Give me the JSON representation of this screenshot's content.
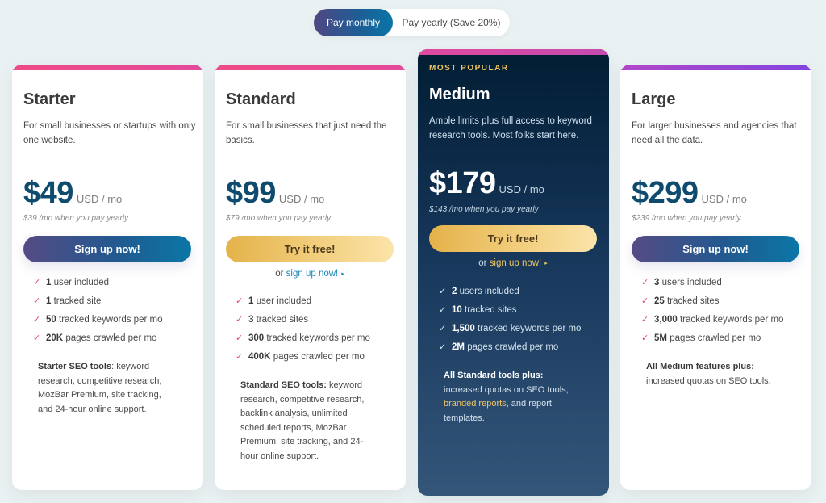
{
  "billing_toggle": {
    "monthly_label": "Pay monthly",
    "yearly_label": "Pay yearly (Save 20%)",
    "selected": "monthly"
  },
  "colors": {
    "accent_pink": "#e0457b",
    "primary_gradient_start": "#554b85",
    "primary_gradient_end": "#0a77a7",
    "gold": "#f0c560",
    "price_blue": "#0e4b6e",
    "featured_bg": "#16365a"
  },
  "plans": [
    {
      "name": "Starter",
      "description": "For small businesses or startups with only one website.",
      "price": "$49",
      "unit": "USD / mo",
      "yearly_note": "$39 /mo when you pay yearly",
      "cta_label": "Sign up now!",
      "features": [
        {
          "value": "1",
          "text": "user included"
        },
        {
          "value": "1",
          "text": "tracked site"
        },
        {
          "value": "50",
          "text": "tracked keywords per mo"
        },
        {
          "value": "20K",
          "text": "pages crawled per mo"
        }
      ],
      "tools_bold": "Starter SEO tools",
      "tools_text": ": keyword research, competitive research, MozBar Premium, site tracking, and 24-hour online support."
    },
    {
      "name": "Standard",
      "description": "For small businesses that just need the basics.",
      "price": "$99",
      "unit": "USD / mo",
      "yearly_note": "$79 /mo when you pay yearly",
      "cta_label": "Try it free!",
      "alt_prefix": "or",
      "alt_link": "sign up now!",
      "features": [
        {
          "value": "1",
          "text": "user included"
        },
        {
          "value": "3",
          "text": "tracked sites"
        },
        {
          "value": "300",
          "text": "tracked keywords per mo"
        },
        {
          "value": "400K",
          "text": "pages crawled per mo"
        }
      ],
      "tools_bold": "Standard SEO tools:",
      "tools_text": " keyword research, competitive research, backlink analysis, unlimited scheduled reports, MozBar Premium, site tracking, and 24-hour online support."
    },
    {
      "badge": "MOST POPULAR",
      "name": "Medium",
      "description": "Ample limits plus full access to keyword research tools. Most folks start here.",
      "price": "$179",
      "unit": "USD / mo",
      "yearly_note": "$143 /mo when you pay yearly",
      "cta_label": "Try it free!",
      "alt_prefix": "or",
      "alt_link": "sign up now!",
      "features": [
        {
          "value": "2",
          "text": "users included"
        },
        {
          "value": "10",
          "text": "tracked sites"
        },
        {
          "value": "1,500",
          "text": "tracked keywords per mo"
        },
        {
          "value": "2M",
          "text": "pages crawled per mo"
        }
      ],
      "tools_bold": "All Standard tools plus:",
      "tools_text_1": " increased quotas on SEO tools, ",
      "tools_highlight": "branded reports",
      "tools_text_2": ", and report templates."
    },
    {
      "name": "Large",
      "description": "For larger businesses and agencies that need all the data.",
      "price": "$299",
      "unit": "USD / mo",
      "yearly_note": "$239 /mo when you pay yearly",
      "cta_label": "Sign up now!",
      "features": [
        {
          "value": "3",
          "text": "users included"
        },
        {
          "value": "25",
          "text": "tracked sites"
        },
        {
          "value": "3,000",
          "text": "tracked keywords per mo"
        },
        {
          "value": "5M",
          "text": "pages crawled per mo"
        }
      ],
      "tools_bold": "All Medium features plus:",
      "tools_text": " increased quotas on SEO tools."
    }
  ],
  "icons": {
    "check": "✓",
    "arrow": "▸"
  }
}
